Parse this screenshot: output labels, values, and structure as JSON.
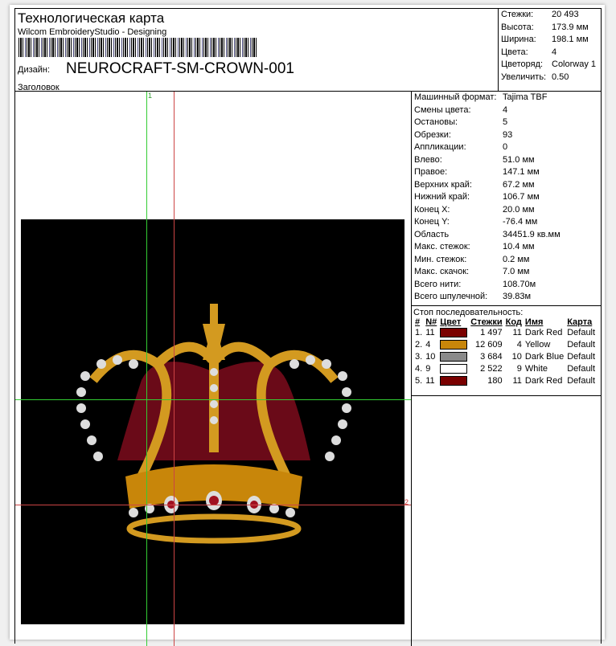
{
  "header": {
    "title": "Технологическая карта",
    "subtitle": "Wilcom EmbroideryStudio - Designing",
    "design_label": "Дизайн:",
    "design_name": "NEUROCRAFT-SM-CROWN-001",
    "heading_label": "Заголовок"
  },
  "stats": [
    {
      "k": "Стежки:",
      "v": "20 493"
    },
    {
      "k": "Высота:",
      "v": "173.9 мм"
    },
    {
      "k": "Ширина:",
      "v": "198.1 мм"
    },
    {
      "k": "Цвета:",
      "v": "4"
    },
    {
      "k": "Цветоряд:",
      "v": "Colorway 1"
    },
    {
      "k": "Увеличить:",
      "v": "0.50"
    }
  ],
  "details": [
    {
      "k": "Машинный формат:",
      "v": "Tajima TBF"
    },
    {
      "k": "Смены цвета:",
      "v": "4"
    },
    {
      "k": "Остановы:",
      "v": "5"
    },
    {
      "k": "Обрезки:",
      "v": "93"
    },
    {
      "k": "Аппликации:",
      "v": "0"
    },
    {
      "k": "Влево:",
      "v": "51.0 мм"
    },
    {
      "k": "Правое:",
      "v": "147.1 мм"
    },
    {
      "k": "Верхних край:",
      "v": "67.2 мм"
    },
    {
      "k": "Нижний край:",
      "v": "106.7 мм"
    },
    {
      "k": "Конец X:",
      "v": "20.0 мм"
    },
    {
      "k": "Конец Y:",
      "v": "-76.4 мм"
    },
    {
      "k": "Область",
      "v": "34451.9 кв.мм"
    },
    {
      "k": "Макс. стежок:",
      "v": "10.4 мм"
    },
    {
      "k": "Мин. стежок:",
      "v": "0.2 мм"
    },
    {
      "k": "Макс. скачок:",
      "v": "7.0 мм"
    },
    {
      "k": "Всего нити:",
      "v": "108.70м"
    },
    {
      "k": "Всего шпулечной:",
      "v": "39.83м"
    }
  ],
  "sequence": {
    "title": "Стоп последовательность:",
    "headers": [
      "#",
      "N#",
      "Цвет",
      "Стежки",
      "Код",
      "Имя",
      "Карта"
    ],
    "rows": [
      {
        "n": "1.",
        "num": "11",
        "color": "#7a0000",
        "stitches": "1 497",
        "code": "11",
        "name": "Dark Red",
        "map": "Default"
      },
      {
        "n": "2.",
        "num": "4",
        "color": "#c8860a",
        "stitches": "12 609",
        "code": "4",
        "name": "Yellow",
        "map": "Default"
      },
      {
        "n": "3.",
        "num": "10",
        "color": "#8a8a8a",
        "stitches": "3 684",
        "code": "10",
        "name": "Dark Blue",
        "map": "Default"
      },
      {
        "n": "4.",
        "num": "9",
        "color": "#ffffff",
        "stitches": "2 522",
        "code": "9",
        "name": "White",
        "map": "Default"
      },
      {
        "n": "5.",
        "num": "11",
        "color": "#7a0000",
        "stitches": "180",
        "code": "11",
        "name": "Dark Red",
        "map": "Default"
      }
    ]
  },
  "markers": {
    "m1": "1",
    "m2": "2"
  }
}
